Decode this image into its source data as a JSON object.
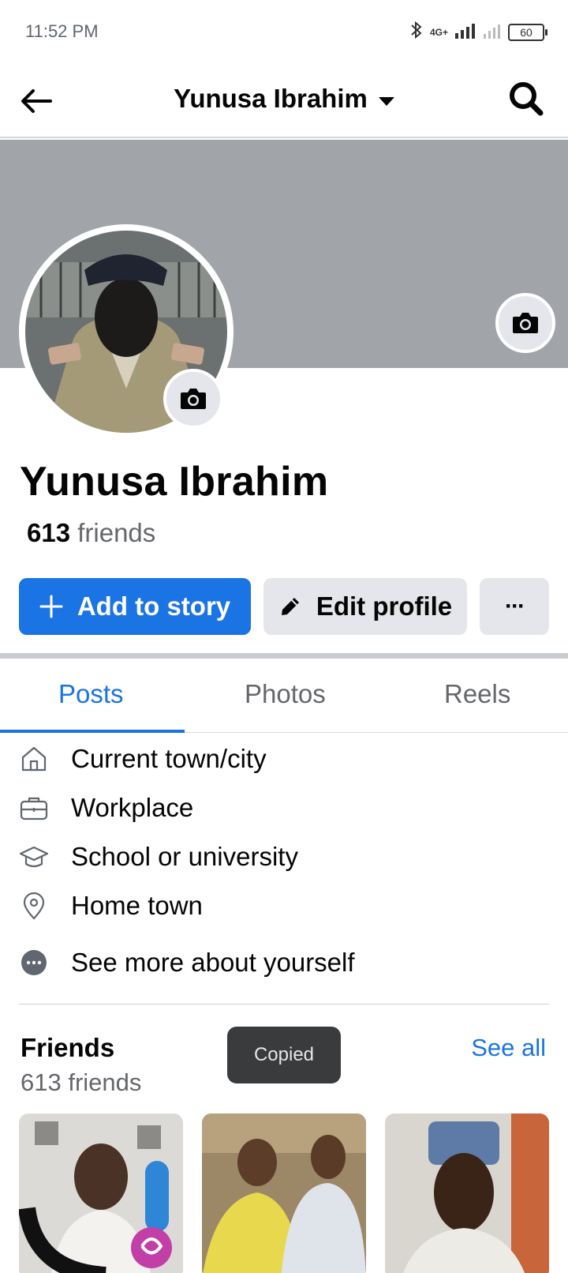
{
  "status_bar": {
    "time": "11:52 PM",
    "network": "4G+",
    "battery": "60"
  },
  "header": {
    "title": "Yunusa Ibrahim"
  },
  "profile": {
    "name": "Yunusa Ibrahim",
    "friend_count": "613",
    "friend_suffix": " friends"
  },
  "actions": {
    "add_story": "Add to story",
    "edit_profile": "Edit profile",
    "more": "···"
  },
  "tabs": [
    {
      "label": "Posts",
      "active": true
    },
    {
      "label": "Photos",
      "active": false
    },
    {
      "label": "Reels",
      "active": false
    }
  ],
  "intro": [
    {
      "label": "Current town/city",
      "icon": "home-icon"
    },
    {
      "label": "Workplace",
      "icon": "briefcase-icon"
    },
    {
      "label": "School or university",
      "icon": "graduation-cap-icon"
    },
    {
      "label": "Home town",
      "icon": "location-pin-icon"
    },
    {
      "label": "See more about yourself",
      "icon": "more-dots-icon"
    }
  ],
  "friends_section": {
    "title": "Friends",
    "subtitle": "613 friends",
    "see_all": "See all"
  },
  "toast": "Copied",
  "colors": {
    "accent": "#1b74e4",
    "cover": "#a1a4a8",
    "button_gray": "#e4e6eb"
  }
}
